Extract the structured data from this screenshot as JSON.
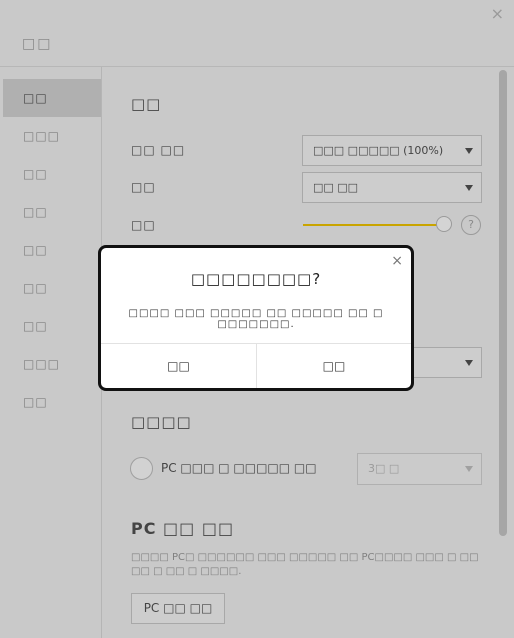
{
  "window": {
    "title": "□□",
    "close_glyph": "×"
  },
  "sidebar": {
    "items": [
      {
        "label": "□□",
        "active": true
      },
      {
        "label": "□□□"
      },
      {
        "label": "□□"
      },
      {
        "label": "□□"
      },
      {
        "label": "□□"
      },
      {
        "label": "□□"
      },
      {
        "label": "□□"
      },
      {
        "label": "□□□"
      },
      {
        "label": "□□"
      }
    ]
  },
  "main": {
    "section1_title": "□□",
    "rows": [
      {
        "label": "□□ □□",
        "value": "□□□ □□□□□ (100%)"
      },
      {
        "label": "□□",
        "value": "□□ □□"
      },
      {
        "label": "□□"
      }
    ],
    "help_glyph": "?",
    "section2_title": "□□□□",
    "radio_label": "PC □□□ □ □□□□□ □□",
    "disabled_select_value": "3□ □",
    "section3_title": "PC □□ □□",
    "description": "□□□□ PC□ □□□□□□ □□□ □□□□□ □□ PC□□□□ □□□ □ □□ □□ □ □□ □ □□□□.",
    "pc_button_label": "PC □□ □□"
  },
  "modal": {
    "title": "□□□□□□□□?",
    "message": "□□□□ □□□ □□□□□ □□ □□□□□ □□ □ □□□□□□□.",
    "close_glyph": "×",
    "cancel_label": "□□",
    "ok_label": "□□"
  },
  "colors": {
    "slider_accent": "#c9a400",
    "overlay_bg": "#c9c9c9",
    "modal_border": "#111111"
  }
}
